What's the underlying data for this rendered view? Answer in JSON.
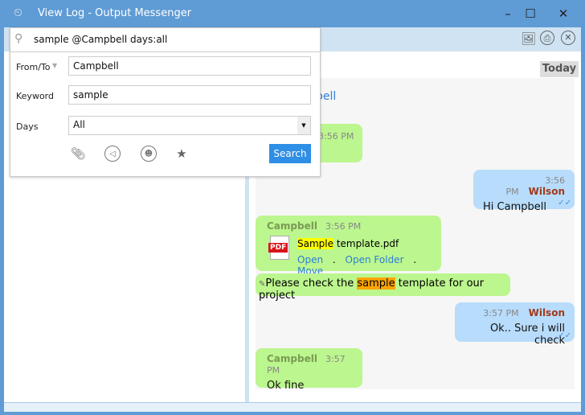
{
  "window": {
    "title": "View Log - Output Messenger",
    "controls": [
      "minimize",
      "maximize",
      "close"
    ]
  },
  "header": {
    "icons": [
      "image-icon",
      "print-icon",
      "close-circle-icon"
    ]
  },
  "search_popup": {
    "query": "sample @Campbell days:all",
    "from_to_label": "From/To",
    "from_to_value": "Campbell",
    "keyword_label": "Keyword",
    "keyword_value": "sample",
    "days_label": "Days",
    "days_value": "All",
    "filter_icons": [
      "paperclip-icon",
      "announcement-icon",
      "group-icon",
      "star-icon"
    ],
    "search_label": "Search"
  },
  "chat": {
    "date_label": "Today",
    "partial_header": "bell",
    "messages": [
      {
        "from": "Campbell",
        "time": "3:56 PM",
        "text": ""
      },
      {
        "from": "Wilson",
        "time": "3:56 PM",
        "text": "Hi Campbell"
      },
      {
        "from": "Campbell",
        "time": "3:56 PM",
        "file": {
          "highlight": "Sample",
          "rest": " template.pdf",
          "badge": "PDF",
          "actions": [
            "Open",
            "Open Folder",
            "Move"
          ],
          "sep": "."
        }
      },
      {
        "text_pre": "Please check the ",
        "highlight": "sample",
        "text_post": " template for our project"
      },
      {
        "from": "Wilson",
        "time": "3:57 PM",
        "text": "Ok.. Sure i will check"
      },
      {
        "from": "Campbell",
        "time": "3:57 PM",
        "text": "Ok fine"
      }
    ]
  },
  "colors": {
    "titlebar": "#5f9bd5",
    "bubble_in": "#bcf68e",
    "bubble_out": "#b8dcfb",
    "search_button": "#2f8ee5",
    "highlight_yellow": "#ffff00",
    "highlight_orange": "#ffa500"
  }
}
